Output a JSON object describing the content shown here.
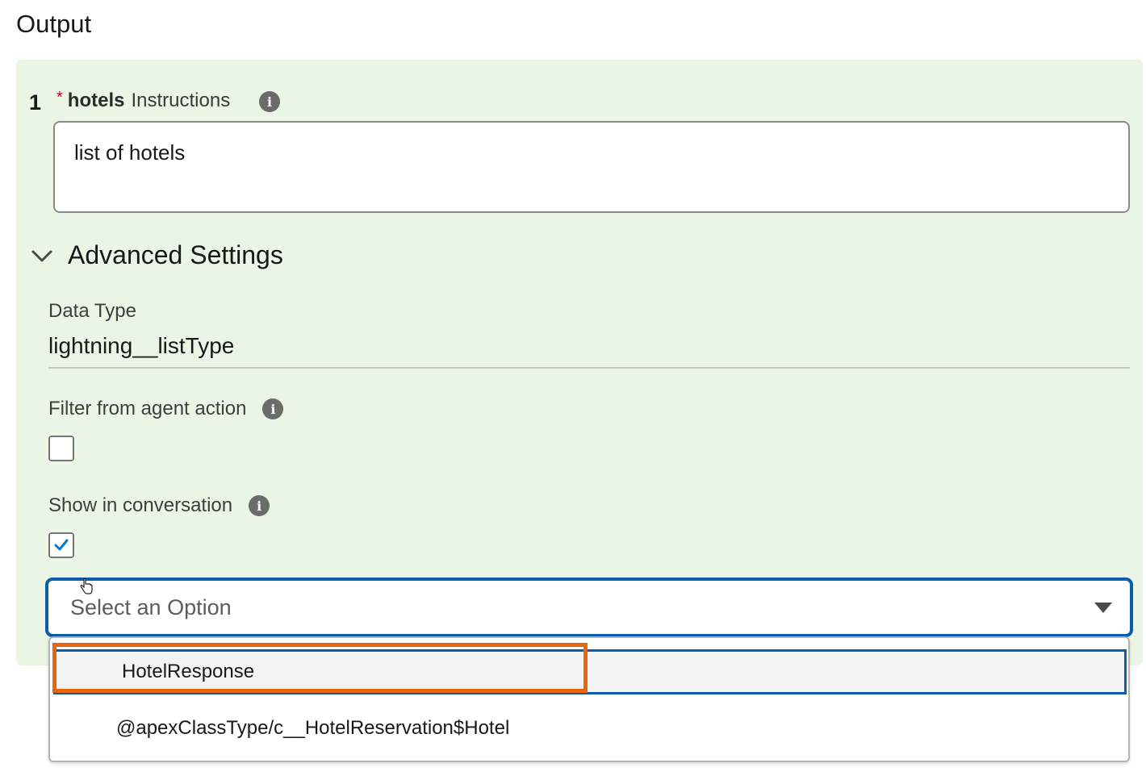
{
  "page": {
    "title": "Output"
  },
  "output": {
    "row_number": "1",
    "required_marker": "*",
    "field_name": "hotels",
    "field_suffix": "Instructions",
    "instructions_value": "list of hotels"
  },
  "advanced": {
    "title": "Advanced Settings",
    "data_type_label": "Data Type",
    "data_type_value": "lightning__listType",
    "filter_label": "Filter from agent action",
    "filter_checked": false,
    "show_label": "Show in conversation",
    "show_checked": true
  },
  "select": {
    "placeholder": "Select an Option",
    "options": [
      {
        "label": "HotelResponse",
        "highlighted": true
      },
      {
        "label": "@apexClassType/c__HotelReservation$Hotel",
        "highlighted": false
      }
    ]
  },
  "colors": {
    "panel_bg": "#eaf5e5",
    "focus_blue": "#0b5cab",
    "annotation_orange": "#e8650a",
    "required_red": "#ba0517"
  },
  "icons": [
    "info-icon",
    "chevron-down-icon",
    "checkmark-icon",
    "caret-down-icon",
    "hand-cursor-icon"
  ]
}
